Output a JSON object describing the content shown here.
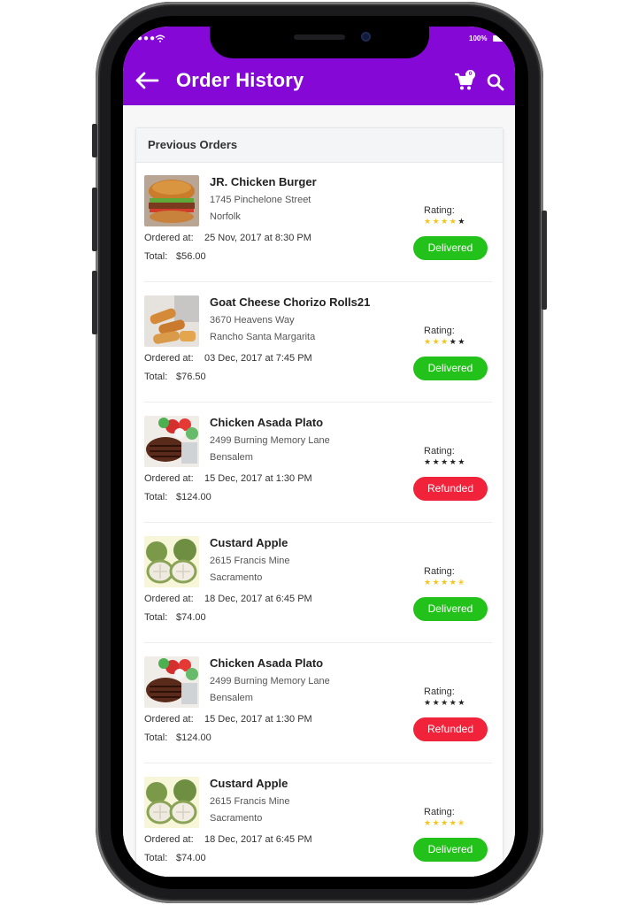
{
  "status_bar": {
    "signal": "●●●",
    "battery": "100%"
  },
  "header": {
    "title": "Order History",
    "cart_badge": "0"
  },
  "section_title": "Previous Orders",
  "labels": {
    "ordered_at": "Ordered at:",
    "total": "Total:",
    "rating": "Rating:"
  },
  "orders": [
    {
      "name": "JR. Chicken Burger",
      "address_line1": "1745 Pinchelone Street",
      "address_line2": "Norfolk",
      "ordered_at": "25 Nov, 2017 at 8:30 PM",
      "total": "$56.00",
      "rating": 4,
      "status": "Delivered",
      "image": "burger"
    },
    {
      "name": "Goat Cheese Chorizo Rolls21",
      "address_line1": "3670 Heavens Way",
      "address_line2": "Rancho Santa Margarita",
      "ordered_at": "03 Dec, 2017 at 7:45 PM",
      "total": "$76.50",
      "rating": 3,
      "status": "Delivered",
      "image": "rolls"
    },
    {
      "name": "Chicken Asada Plato",
      "address_line1": "2499 Burning Memory Lane",
      "address_line2": "Bensalem",
      "ordered_at": "15 Dec, 2017 at 1:30 PM",
      "total": "$124.00",
      "rating": 0,
      "status": "Refunded",
      "image": "steak"
    },
    {
      "name": "Custard Apple",
      "address_line1": "2615 Francis Mine",
      "address_line2": "Sacramento",
      "ordered_at": "18 Dec, 2017 at 6:45 PM",
      "total": "$74.00",
      "rating": 4.5,
      "status": "Delivered",
      "image": "custard-apple"
    },
    {
      "name": "Chicken Asada Plato",
      "address_line1": "2499 Burning Memory Lane",
      "address_line2": "Bensalem",
      "ordered_at": "15 Dec, 2017 at 1:30 PM",
      "total": "$124.00",
      "rating": 0,
      "status": "Refunded",
      "image": "steak"
    },
    {
      "name": "Custard Apple",
      "address_line1": "2615 Francis Mine",
      "address_line2": "Sacramento",
      "ordered_at": "18 Dec, 2017 at 6:45 PM",
      "total": "$74.00",
      "rating": 4.5,
      "status": "Delivered",
      "image": "custard-apple"
    }
  ],
  "colors": {
    "header": "#8508d6",
    "delivered": "#22c21a",
    "refunded": "#f0233b",
    "star": "#f5c518"
  }
}
